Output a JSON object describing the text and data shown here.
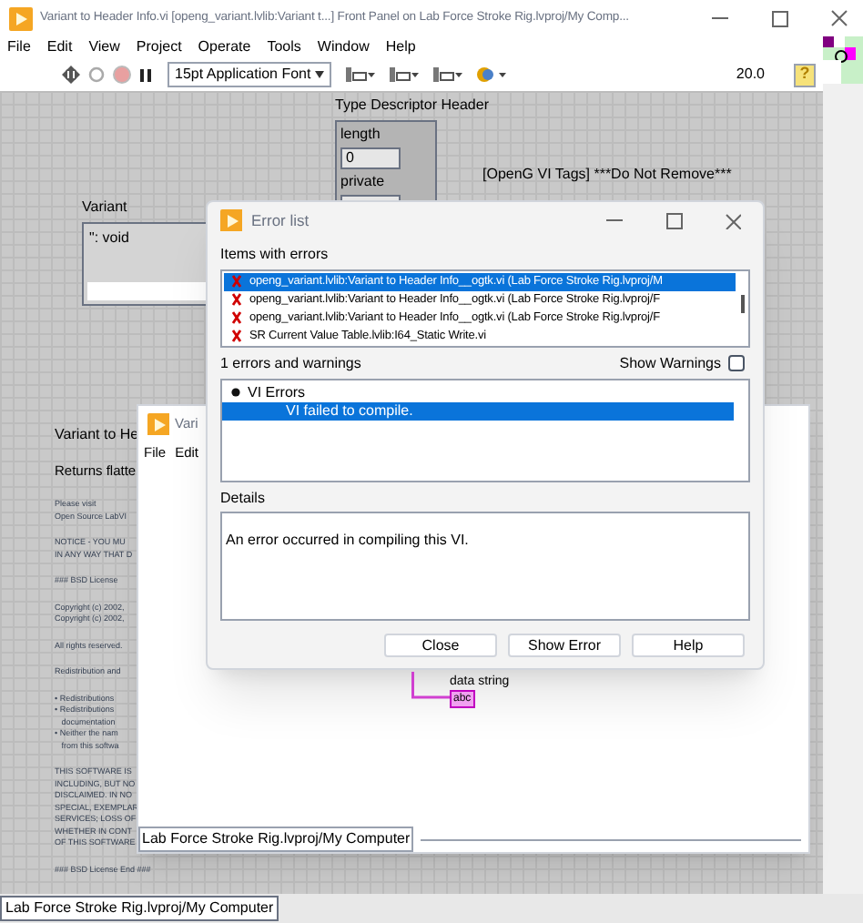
{
  "main_window": {
    "title": "Variant to Header Info.vi [openg_variant.lvlib:Variant t...] Front Panel on Lab Force Stroke Rig.lvproj/My Comp...",
    "menu": [
      "File",
      "Edit",
      "View",
      "Project",
      "Operate",
      "Tools",
      "Window",
      "Help"
    ],
    "toolbar": {
      "font": "15pt Application Font",
      "zoom": "20.0",
      "help": "?"
    },
    "front_panel": {
      "cluster_label": "Type Descriptor Header",
      "fields": [
        {
          "label": "length",
          "value": "0"
        },
        {
          "label": "private"
        }
      ],
      "tags": "[OpenG VI Tags] ***Do Not Remove***",
      "variant_label": "Variant",
      "variant_value": "\": void",
      "description_title": "Variant to He",
      "description_subtitle": "Returns flatte",
      "license_paragraphs": [
        [
          "Please visit",
          "Open Source LabVI"
        ],
        [
          "NOTICE - YOU MU",
          "IN ANY WAY THAT D"
        ],
        [
          "### BSD License"
        ],
        [
          "Copyright (c) 2002,",
          "Copyright (c) 2002,"
        ],
        [
          "All rights reserved."
        ],
        [
          "Redistribution and"
        ],
        [
          "• Redistributions",
          "• Redistributions",
          "   documentation",
          "• Neither the nam",
          "   from this softwa"
        ],
        [
          "THIS SOFTWARE IS",
          "INCLUDING, BUT NO",
          "DISCLAIMED. IN NO",
          "SPECIAL, EXEMPLAR",
          "SERVICES; LOSS OF",
          "WHETHER IN CONT",
          "OF THIS SOFTWARE"
        ],
        [
          "### BSD License End ###"
        ]
      ],
      "wire_label": "data string",
      "wire_terminal": "abc"
    },
    "status_bar": "Lab Force Stroke Rig.lvproj/My Computer"
  },
  "back_window": {
    "title": "Vari",
    "menu": [
      "File",
      "Edit"
    ],
    "status_bar": "Lab Force Stroke Rig.lvproj/My Computer"
  },
  "error_dialog": {
    "title": "Error list",
    "items_label": "Items with errors",
    "items": [
      {
        "text": "openg_variant.lvlib:Variant to Header Info__ogtk.vi (Lab Force Stroke Rig.lvproj/M",
        "selected": true
      },
      {
        "text": "openg_variant.lvlib:Variant to Header Info__ogtk.vi (Lab Force Stroke Rig.lvproj/F",
        "selected": false
      },
      {
        "text": "openg_variant.lvlib:Variant to Header Info__ogtk.vi (Lab Force Stroke Rig.lvproj/F",
        "selected": false
      },
      {
        "text": "SR Current Value Table.lvlib:I64_Static Write.vi",
        "selected": false
      }
    ],
    "count_label": "1 errors and warnings",
    "show_warnings": {
      "label": "Show Warnings",
      "checked": false
    },
    "tree": [
      {
        "text": "VI Errors",
        "selected": false,
        "children": [
          {
            "text": "VI failed to compile.",
            "selected": true
          }
        ]
      }
    ],
    "details_label": "Details",
    "details": "An error occurred in compiling this VI.",
    "buttons": [
      "Close",
      "Show Error",
      "Help"
    ]
  }
}
